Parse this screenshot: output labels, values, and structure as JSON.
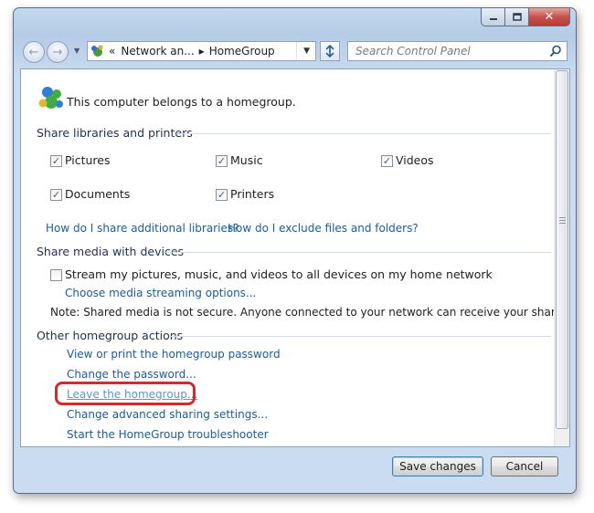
{
  "titlebar": {
    "minimize_icon": "minimize-icon",
    "maximize_icon": "maximize-icon",
    "close_icon": "close-icon",
    "close_glyph": "✕"
  },
  "nav": {
    "back_icon": "back-arrow-icon",
    "forward_icon": "forward-arrow-icon",
    "recent_icon": "dropdown-arrow-icon",
    "back_glyph": "←",
    "forward_glyph": "→",
    "recent_glyph": "▼"
  },
  "address": {
    "overflow": "«",
    "crumb1": "Network an...",
    "separator": "▸",
    "crumb2": "HomeGroup",
    "dropdown_glyph": "▼"
  },
  "search": {
    "placeholder": "Search Control Panel"
  },
  "content": {
    "homegroup_status": "This computer belongs to a homegroup.",
    "share_libraries": {
      "title": "Share libraries and printers",
      "items": [
        {
          "label": "Pictures",
          "checked": true
        },
        {
          "label": "Music",
          "checked": true
        },
        {
          "label": "Videos",
          "checked": true
        },
        {
          "label": "Documents",
          "checked": true
        },
        {
          "label": "Printers",
          "checked": true
        }
      ],
      "links": [
        "How do I share additional libraries?",
        "How do I exclude files and folders?"
      ]
    },
    "share_media": {
      "title": "Share media with devices",
      "stream_label": "Stream my pictures, music, and videos to all devices on my home network",
      "stream_checked": false,
      "options_link": "Choose media streaming options...",
      "note": "Note: Shared media is not secure. Anyone connected to your network can receive your shared media."
    },
    "other_actions": {
      "title": "Other homegroup actions",
      "links": [
        "View or print the homegroup password",
        "Change the password...",
        "Leave the homegroup...",
        "Change advanced sharing settings...",
        "Start the HomeGroup troubleshooter"
      ]
    },
    "check_glyph": "✓"
  },
  "footer": {
    "save": "Save changes",
    "cancel": "Cancel"
  },
  "colors": {
    "link": "#1a5c9c",
    "highlight": "#d42a2a",
    "frame": "#c3d8ee"
  }
}
